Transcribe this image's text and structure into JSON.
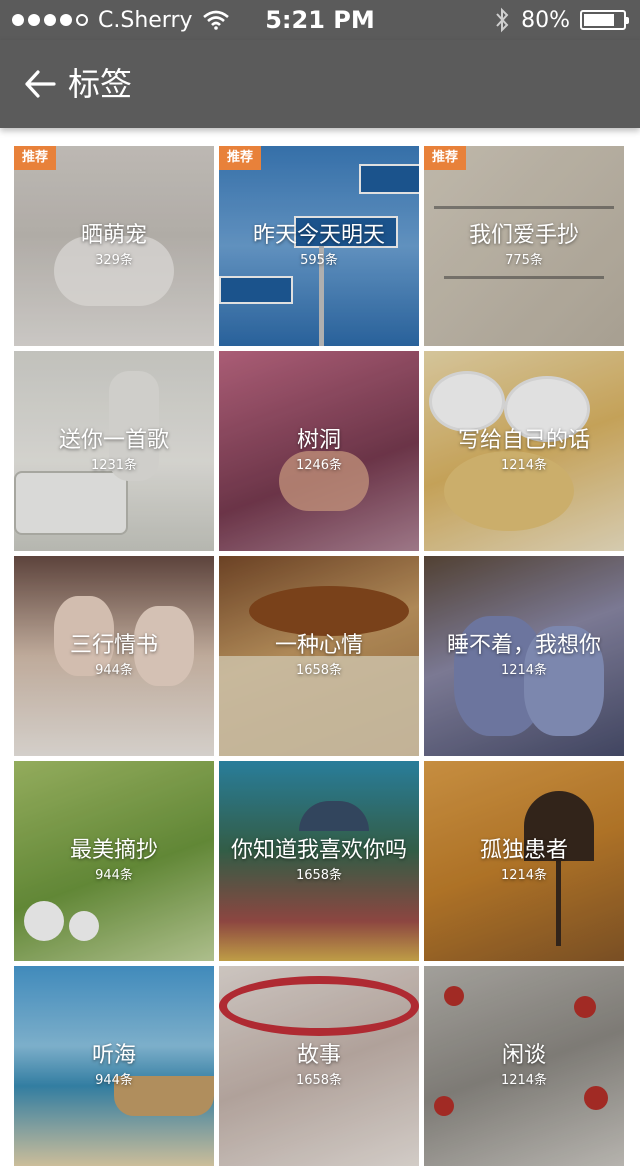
{
  "status_bar": {
    "carrier": "C.Sherry",
    "time": "5:21 PM",
    "battery_percent": "80%",
    "battery_level": 0.8,
    "signal_dots_filled": 4,
    "signal_dots_total": 5
  },
  "nav": {
    "title": "标签",
    "back_icon": "arrow-left-icon"
  },
  "colors": {
    "bar_background": "#5b5b5b",
    "badge": "#e8813a",
    "text_on_image": "#ffffff"
  },
  "tags": [
    {
      "title": "晒萌宠",
      "count": "329条",
      "badge": "推荐"
    },
    {
      "title": "昨天今天明天",
      "count": "595条",
      "badge": "推荐"
    },
    {
      "title": "我们爱手抄",
      "count": "775条",
      "badge": "推荐"
    },
    {
      "title": "送你一首歌",
      "count": "1231条",
      "badge": ""
    },
    {
      "title": "树洞",
      "count": "1246条",
      "badge": ""
    },
    {
      "title": "写给自己的话",
      "count": "1214条",
      "badge": ""
    },
    {
      "title": "三行情书",
      "count": "944条",
      "badge": ""
    },
    {
      "title": "一种心情",
      "count": "1658条",
      "badge": ""
    },
    {
      "title": "睡不着，我想你",
      "count": "1214条",
      "badge": ""
    },
    {
      "title": "最美摘抄",
      "count": "944条",
      "badge": ""
    },
    {
      "title": "你知道我喜欢你吗",
      "count": "1658条",
      "badge": ""
    },
    {
      "title": "孤独患者",
      "count": "1214条",
      "badge": ""
    },
    {
      "title": "听海",
      "count": "944条",
      "badge": ""
    },
    {
      "title": "故事",
      "count": "1658条",
      "badge": ""
    },
    {
      "title": "闲谈",
      "count": "1214条",
      "badge": ""
    }
  ]
}
